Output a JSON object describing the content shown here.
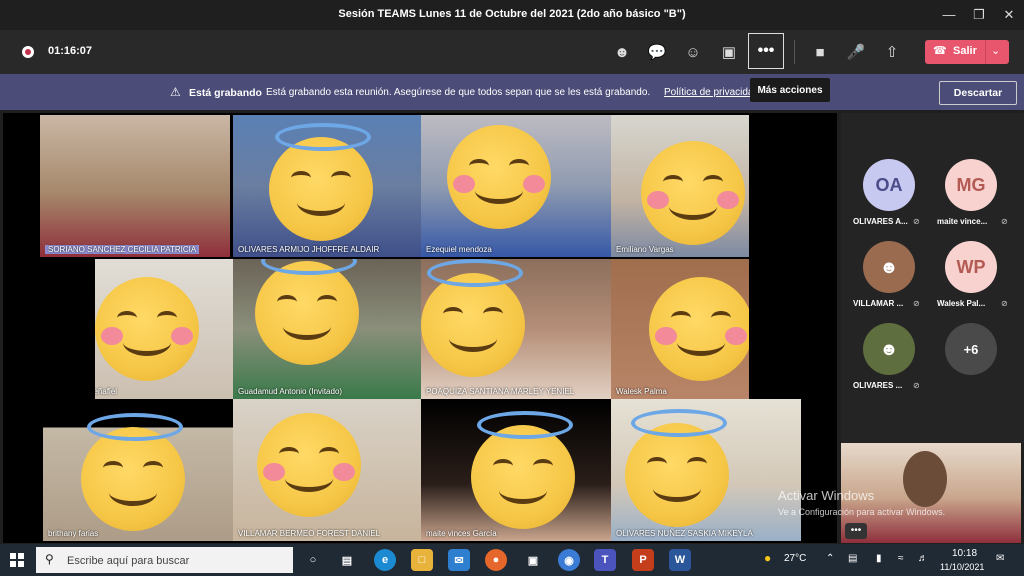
{
  "window": {
    "title": "Sesión TEAMS Lunes 11 de Octubre del 2021 (2do año básico \"B\")"
  },
  "toolbar": {
    "timer": "01:16:07",
    "leave_label": "Salir",
    "tooltip": "Más acciones"
  },
  "banner": {
    "bold": "Está grabando",
    "message": "Está grabando esta reunión. Asegúrese de que todos sepan que se les está grabando.",
    "link": "Política de privacidad",
    "dismiss": "Descartar"
  },
  "tiles": [
    {
      "name": "SORIANO SANCHEZ CECILIA PATRICIA"
    },
    {
      "name": "OLIVARES ARMIJO JHOFFRE ALDAIR"
    },
    {
      "name": "Ezequiel mendoza"
    },
    {
      "name": "Emiliano Vargas"
    },
    {
      "name": "sofia López Peñafiel"
    },
    {
      "name": "Guadamud Antonio (Invitado)"
    },
    {
      "name": "POAQUIZA SANTIANA MARLEY YENIEL"
    },
    {
      "name": "Walesk Palma"
    },
    {
      "name": "brithany farias"
    },
    {
      "name": "VILLAMAR BERMEO FOREST DANIEL"
    },
    {
      "name": "maite vinces García"
    },
    {
      "name": "OLIVARES NUÑEZ SASKIA MIKEYLA"
    }
  ],
  "sidebar": [
    {
      "initials": "OA",
      "name": "OLIVARES A...",
      "color": "#c8c9f0",
      "text": "#4b4c8a"
    },
    {
      "initials": "MG",
      "name": "maite vince...",
      "color": "#f7d2cf",
      "text": "#b35a52"
    },
    {
      "initials": "",
      "name": "VILLAMAR ...",
      "color": "#9a6b4f",
      "text": "#fff"
    },
    {
      "initials": "WP",
      "name": "Walesk Pal...",
      "color": "#f7d2cf",
      "text": "#b35a52"
    },
    {
      "initials": "",
      "name": "OLIVARES ...",
      "color": "#5f6e3e",
      "text": "#fff"
    },
    {
      "initials": "+6",
      "name": "",
      "color": "#4a4a4a",
      "text": "#fff"
    }
  ],
  "watermark": {
    "line1": "Activar Windows",
    "line2": "Ve a Configuración para activar Windows."
  },
  "taskbar": {
    "search_placeholder": "Escribe aquí para buscar",
    "weather": "27°C",
    "time": "10:18",
    "date": "11/10/2021"
  }
}
